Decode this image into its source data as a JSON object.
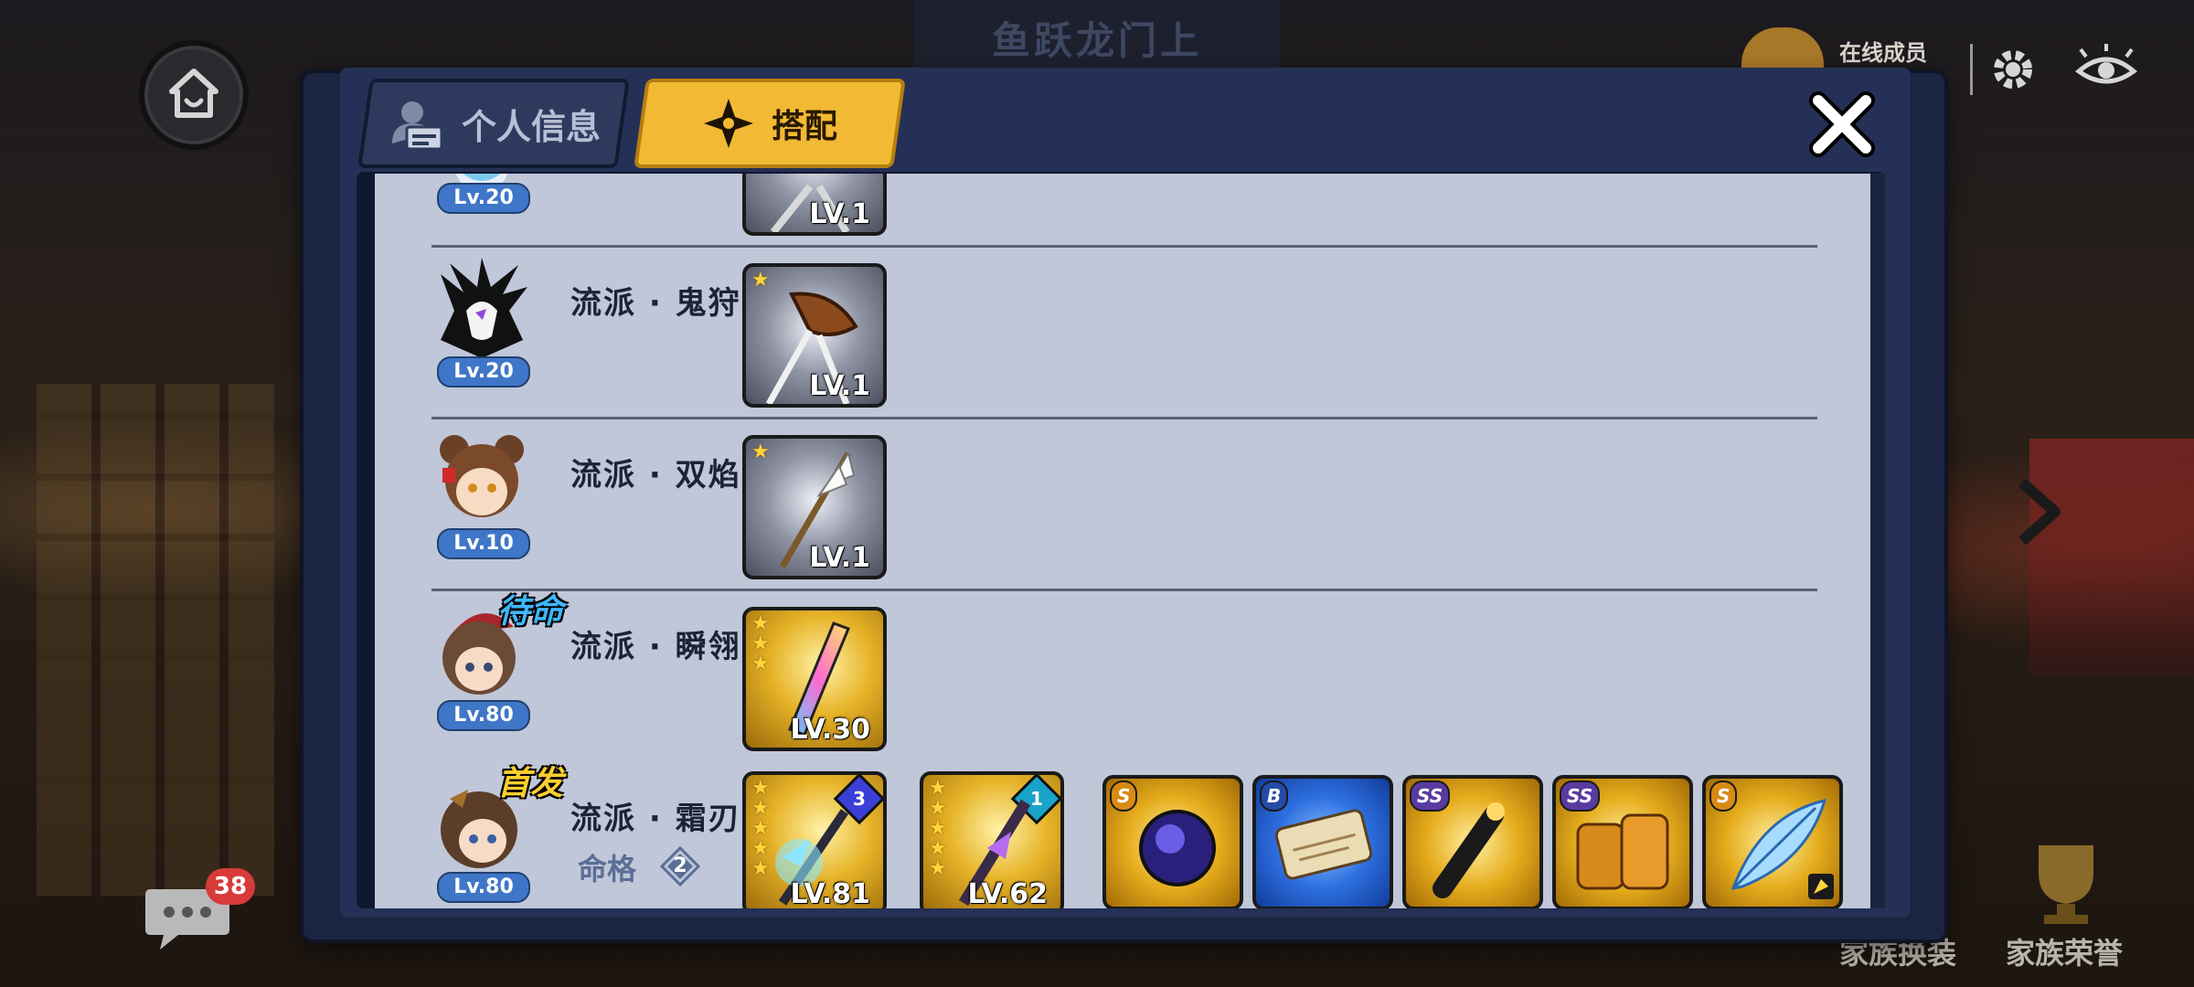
{
  "background": {
    "banner_title": "鱼跃龙门上",
    "online_label": "在线成员",
    "chat_unread_count": "38",
    "bottom_buttons": [
      "家族换装",
      "家族荣誉"
    ]
  },
  "dialog": {
    "tabs": [
      {
        "label": "个人信息",
        "icon": "id-card-icon",
        "active": false
      },
      {
        "label": "搭配",
        "icon": "shuriken-icon",
        "active": true
      }
    ],
    "rows": [
      {
        "level": "Lv.20",
        "school": "",
        "items": [
          {
            "stars": 0,
            "level": "LV.1"
          }
        ]
      },
      {
        "level": "Lv.20",
        "school": "流派 · 鬼狩",
        "items": [
          {
            "stars": 1,
            "level": "LV.1"
          }
        ]
      },
      {
        "level": "Lv.10",
        "school": "流派 · 双焰",
        "items": [
          {
            "stars": 1,
            "level": "LV.1"
          }
        ]
      },
      {
        "level": "Lv.80",
        "school": "流派 · 瞬翎",
        "status": "待命",
        "items": [
          {
            "stars": 3,
            "level": "LV.30"
          }
        ]
      },
      {
        "level": "Lv.80",
        "school": "流派 · 霜刃",
        "status": "首发",
        "mingge_label": "命格",
        "mingge_value": "2",
        "items": [
          {
            "stars": 5,
            "level": "LV.81",
            "tier": "3"
          },
          {
            "stars": 5,
            "level": "LV.62",
            "tier": "1"
          }
        ],
        "skills": [
          {
            "rank": "S"
          },
          {
            "rank": "B"
          },
          {
            "rank": "SS"
          },
          {
            "rank": "SS"
          },
          {
            "rank": "S"
          }
        ]
      }
    ]
  },
  "colors": {
    "active_tab": "#f2b934",
    "panel_bg": "#bfc7d9",
    "level_badge": "#3f76c8",
    "status_standby": "#3fb7ff",
    "status_starter": "#ffcf2e"
  }
}
